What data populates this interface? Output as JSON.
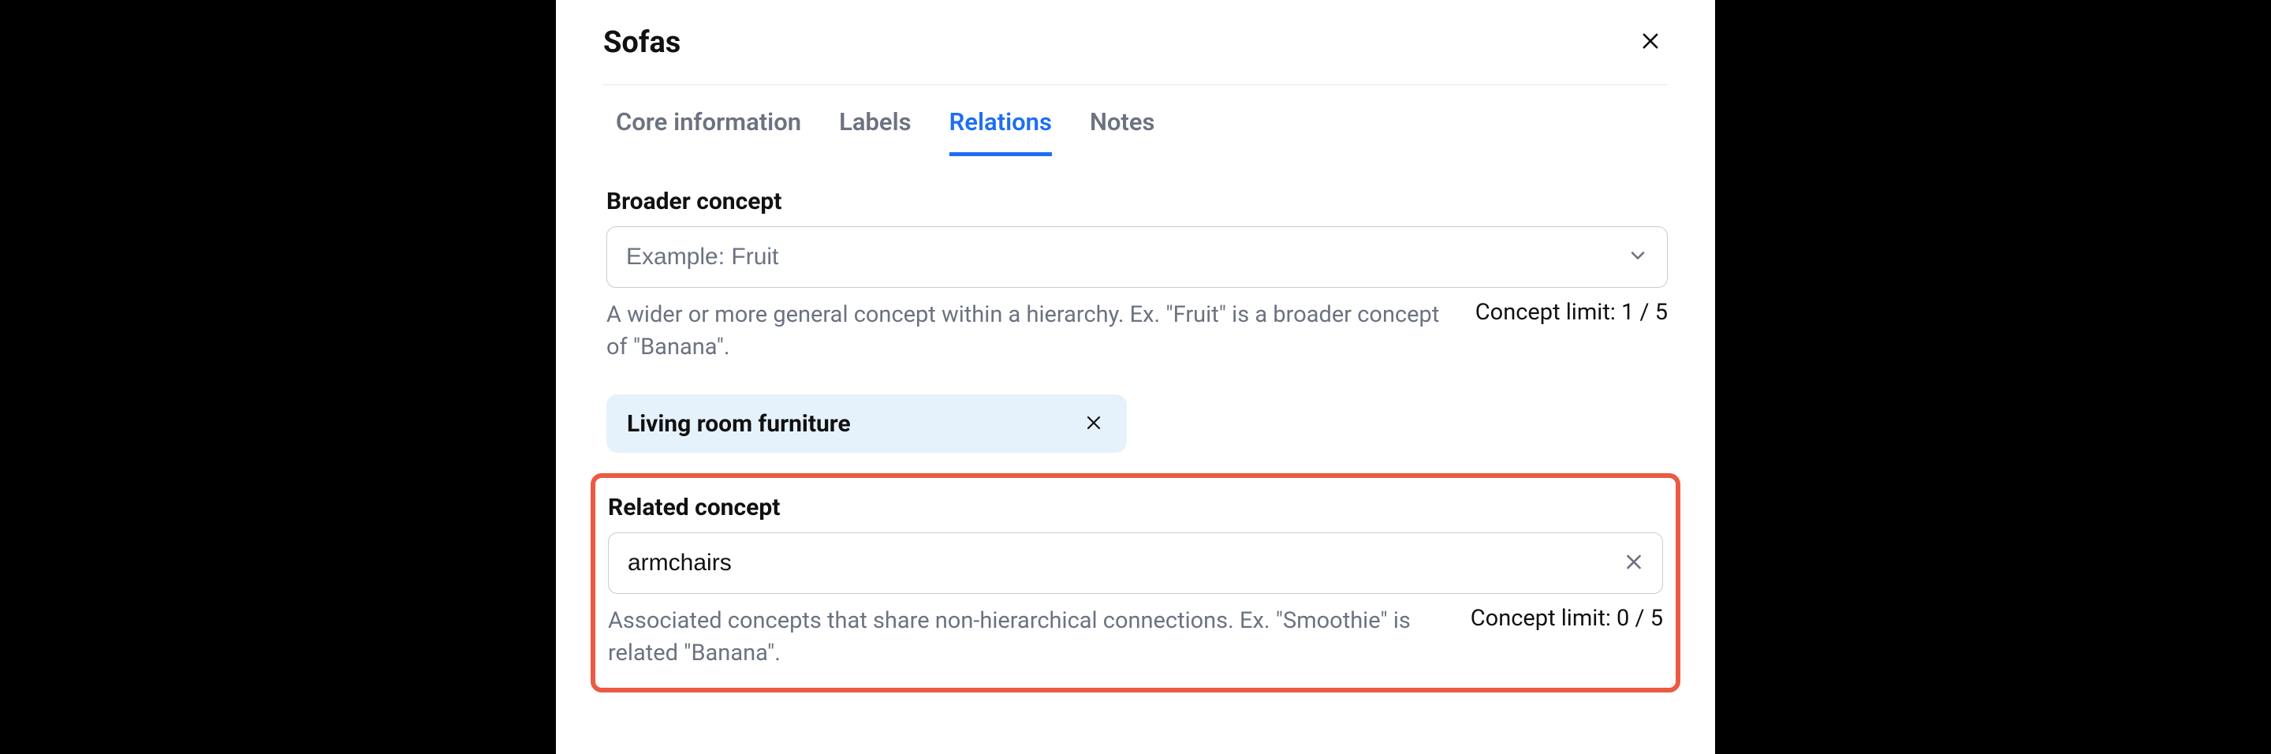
{
  "header": {
    "title": "Sofas"
  },
  "tabs": [
    {
      "id": "core",
      "label": "Core information",
      "active": false
    },
    {
      "id": "labels",
      "label": "Labels",
      "active": false
    },
    {
      "id": "relations",
      "label": "Relations",
      "active": true
    },
    {
      "id": "notes",
      "label": "Notes",
      "active": false
    }
  ],
  "broader": {
    "label": "Broader concept",
    "placeholder": "Example: Fruit",
    "help": "A wider or more general concept within a hierarchy. Ex. \"Fruit\" is a broader concept of \"Banana\".",
    "limit": "Concept limit: 1 / 5",
    "chip": "Living room furniture"
  },
  "related": {
    "label": "Related concept",
    "value": "armchairs",
    "help": "Associated concepts that share non-hierarchical connections. Ex. \"Smoothie\" is related \"Banana\".",
    "limit": "Concept limit: 0 / 5"
  }
}
